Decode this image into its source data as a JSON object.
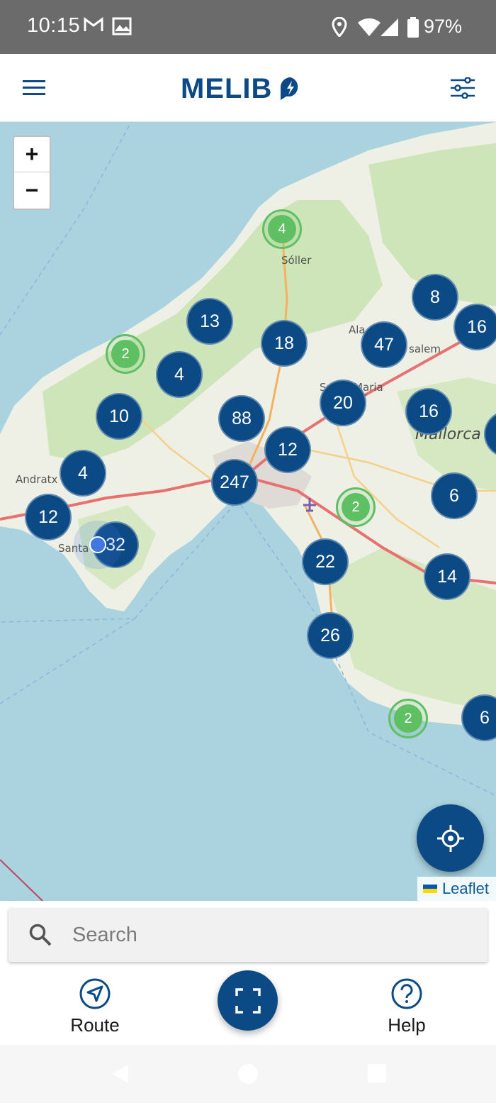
{
  "status_bar": {
    "time": "10:15",
    "battery_percent": "97%",
    "icons": [
      "gmail-icon",
      "gallery-icon",
      "location-icon",
      "wifi-icon",
      "signal-icon",
      "battery-icon"
    ]
  },
  "app_bar": {
    "brand": "MELIB",
    "menu_icon": "hamburger-menu-icon",
    "filter_icon": "filter-sliders-icon",
    "brand_colors": {
      "primary": "#0c4a86"
    }
  },
  "map": {
    "zoom_in_label": "+",
    "zoom_out_label": "−",
    "place_labels": [
      "Sóller",
      "Andratx",
      "Santa",
      "Ala",
      "salem",
      "Santa Maria del Camí",
      "Mallorca"
    ],
    "clusters": [
      {
        "count": "4",
        "kind": "green"
      },
      {
        "count": "13",
        "kind": "blue"
      },
      {
        "count": "18",
        "kind": "blue"
      },
      {
        "count": "47",
        "kind": "blue"
      },
      {
        "count": "8",
        "kind": "blue"
      },
      {
        "count": "16",
        "kind": "blue"
      },
      {
        "count": "2",
        "kind": "green"
      },
      {
        "count": "4",
        "kind": "blue"
      },
      {
        "count": "10",
        "kind": "blue"
      },
      {
        "count": "88",
        "kind": "blue"
      },
      {
        "count": "20",
        "kind": "blue"
      },
      {
        "count": "16",
        "kind": "blue"
      },
      {
        "count": "12",
        "kind": "blue"
      },
      {
        "count": "4",
        "kind": "blue"
      },
      {
        "count": "247",
        "kind": "blue"
      },
      {
        "count": "12",
        "kind": "blue"
      },
      {
        "count": "2",
        "kind": "green"
      },
      {
        "count": "6",
        "kind": "blue"
      },
      {
        "count": "32",
        "kind": "blue"
      },
      {
        "count": "22",
        "kind": "blue"
      },
      {
        "count": "14",
        "kind": "blue"
      },
      {
        "count": "26",
        "kind": "blue"
      },
      {
        "count": "2",
        "kind": "green"
      },
      {
        "count": "6",
        "kind": "blue"
      }
    ],
    "attribution": "Leaflet",
    "locate_icon": "crosshair-locate-icon",
    "colors": {
      "cluster_blue": "#0c4a86",
      "cluster_green": "#5fbf63",
      "sea": "#aad3df",
      "land": "#eef0e6"
    }
  },
  "search": {
    "placeholder": "Search",
    "value": ""
  },
  "bottom_nav": {
    "route_label": "Route",
    "help_label": "Help",
    "scan_icon": "qr-scan-icon"
  }
}
